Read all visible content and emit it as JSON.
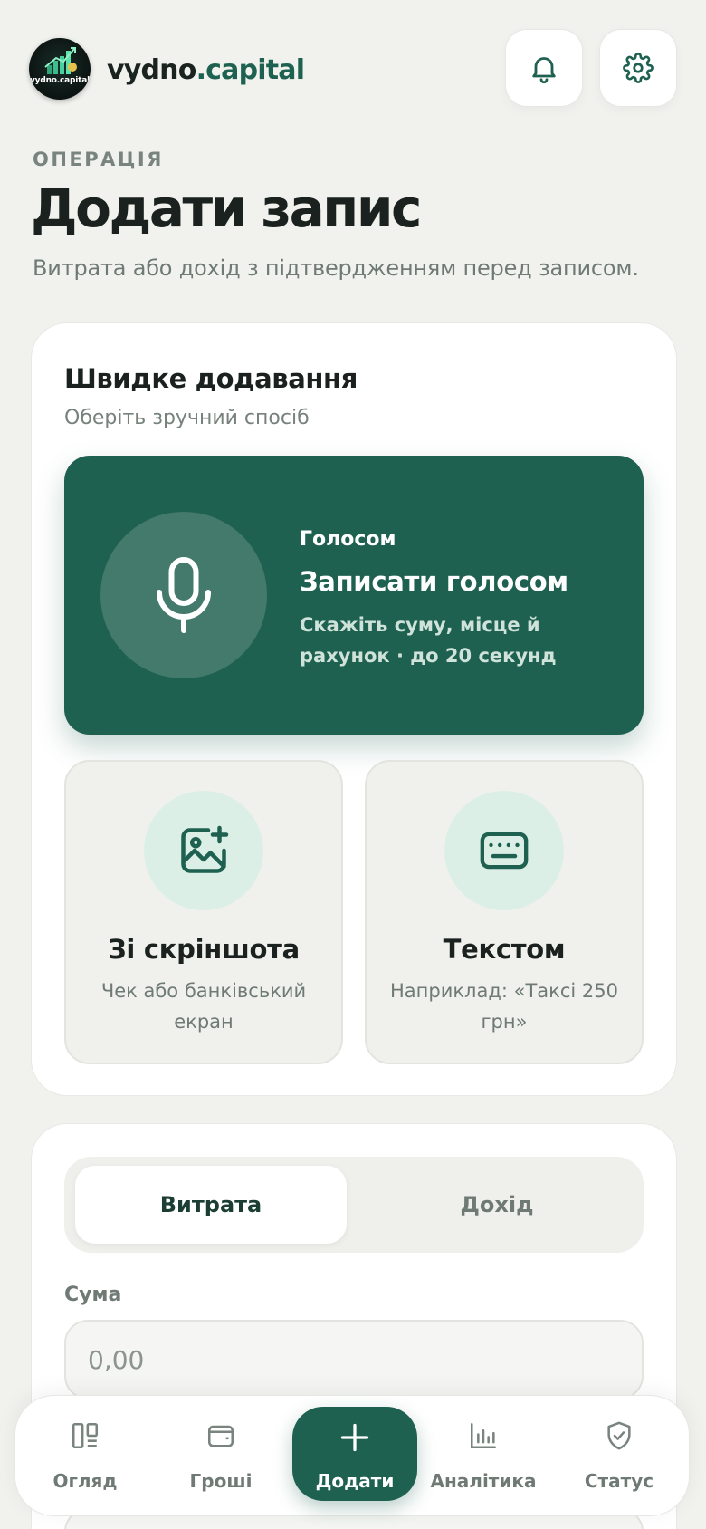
{
  "header": {
    "logo_text": "vydno.capital",
    "brand_main": "vydno",
    "brand_accent": ".capital",
    "icons": [
      "bell-icon",
      "gear-icon"
    ]
  },
  "page": {
    "eyebrow": "ОПЕРАЦІЯ",
    "title": "Додати запис",
    "subtitle": "Витрата або дохід з підтвердженням перед записом."
  },
  "quick_add": {
    "title": "Швидке додавання",
    "subtitle": "Оберіть зручний спосіб",
    "voice": {
      "label": "Голосом",
      "title": "Записати голосом",
      "description": "Скажіть суму, місце й рахунок · до 20 секунд",
      "icon": "microphone-icon"
    },
    "screenshot": {
      "title": "Зі скріншота",
      "description": "Чек або банківський екран",
      "icon": "image-add-icon"
    },
    "text": {
      "title": "Текстом",
      "description": "Наприклад: «Таксі 250 грн»",
      "icon": "keyboard-icon"
    }
  },
  "form": {
    "type_tabs": [
      {
        "label": "Витрата",
        "active": true
      },
      {
        "label": "Дохід",
        "active": false
      }
    ],
    "amount_label": "Сума",
    "amount_placeholder": "0,00",
    "amount_value": ""
  },
  "bottom_nav": {
    "items": [
      {
        "label": "Огляд",
        "icon": "dashboard-icon"
      },
      {
        "label": "Гроші",
        "icon": "wallet-icon"
      },
      {
        "label": "Додати",
        "icon": "plus-icon",
        "active": true
      },
      {
        "label": "Аналітика",
        "icon": "bar-chart-icon"
      },
      {
        "label": "Статус",
        "icon": "shield-check-icon"
      }
    ]
  },
  "colors": {
    "accent": "#1f6150",
    "background": "#f1f2ee",
    "card": "#ffffff",
    "tile_icon_bg": "#dcefe7"
  }
}
